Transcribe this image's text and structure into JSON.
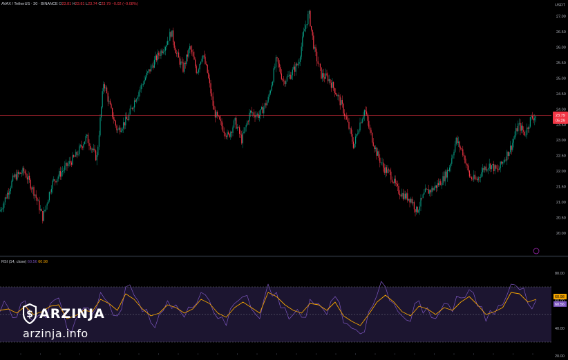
{
  "header": {
    "symbol": "AVAX / TetherUS · 30 · BINANCE",
    "open_label": "O",
    "open": "23.81",
    "high_label": "H",
    "high": "23.81",
    "low_label": "L",
    "low": "23.74",
    "close_label": "C",
    "close": "23.79",
    "change": "−0.02 (−0.08%)"
  },
  "price_axis": {
    "currency": "USDT"
  },
  "last_price_badge": {
    "price": "23.79",
    "countdown": "05:29"
  },
  "rsi_header": {
    "label": "RSI (14, close)",
    "value1": "60.56",
    "value2": "60.98"
  },
  "rsi_badges": {
    "value2": "60.98",
    "value1": "60.56"
  },
  "watermark": {
    "brand": "ARZINJA",
    "site": "arzinja.info"
  },
  "colors": {
    "background": "#000000",
    "up_candle": "#089981",
    "down_candle": "#f23645",
    "rsi_line": "#7e57c2",
    "rsi_ma": "#f7a600",
    "rsi_band_fill": "#1c1530",
    "price_line": "#f23645"
  },
  "chart_data": [
    {
      "type": "candlestick",
      "title": "AVAX / TetherUS · 30 · BINANCE",
      "ylim": [
        19.6,
        27.3
      ],
      "y_ticks": [
        "20.00",
        "20.50",
        "21.00",
        "21.50",
        "22.00",
        "22.50",
        "23.00",
        "23.50",
        "24.00",
        "24.50",
        "25.00",
        "25.50",
        "26.00",
        "26.50",
        "27.00"
      ],
      "last_price": 23.79,
      "close_path": [
        [
          0,
          20.7
        ],
        [
          20,
          21.8
        ],
        [
          35,
          22.0
        ],
        [
          50,
          21.3
        ],
        [
          62,
          20.5
        ],
        [
          75,
          21.6
        ],
        [
          90,
          22.0
        ],
        [
          110,
          22.5
        ],
        [
          125,
          23.1
        ],
        [
          140,
          22.4
        ],
        [
          150,
          24.9
        ],
        [
          160,
          24.0
        ],
        [
          170,
          23.3
        ],
        [
          185,
          23.7
        ],
        [
          195,
          24.3
        ],
        [
          210,
          25.0
        ],
        [
          225,
          25.6
        ],
        [
          240,
          26.1
        ],
        [
          248,
          26.5
        ],
        [
          255,
          25.8
        ],
        [
          265,
          25.3
        ],
        [
          275,
          26.0
        ],
        [
          285,
          25.2
        ],
        [
          293,
          25.8
        ],
        [
          300,
          25.2
        ],
        [
          310,
          23.9
        ],
        [
          320,
          23.5
        ],
        [
          330,
          23.1
        ],
        [
          340,
          23.6
        ],
        [
          350,
          23.0
        ],
        [
          362,
          23.9
        ],
        [
          375,
          23.8
        ],
        [
          388,
          24.3
        ],
        [
          400,
          25.6
        ],
        [
          410,
          24.9
        ],
        [
          420,
          25.1
        ],
        [
          432,
          25.5
        ],
        [
          440,
          26.5
        ],
        [
          447,
          27.1
        ],
        [
          455,
          25.9
        ],
        [
          465,
          25.1
        ],
        [
          475,
          25.0
        ],
        [
          485,
          24.6
        ],
        [
          495,
          24.1
        ],
        [
          505,
          23.4
        ],
        [
          512,
          22.8
        ],
        [
          520,
          23.5
        ],
        [
          528,
          24.0
        ],
        [
          535,
          23.3
        ],
        [
          545,
          22.6
        ],
        [
          555,
          22.1
        ],
        [
          565,
          21.9
        ],
        [
          575,
          21.4
        ],
        [
          585,
          21.2
        ],
        [
          595,
          21.1
        ],
        [
          603,
          20.7
        ],
        [
          615,
          21.3
        ],
        [
          625,
          21.4
        ],
        [
          640,
          21.7
        ],
        [
          650,
          22.1
        ],
        [
          660,
          23.0
        ],
        [
          670,
          22.6
        ],
        [
          680,
          21.8
        ],
        [
          690,
          21.7
        ],
        [
          700,
          22.1
        ],
        [
          710,
          22.2
        ],
        [
          720,
          22.0
        ],
        [
          730,
          22.4
        ],
        [
          740,
          22.8
        ],
        [
          750,
          23.5
        ],
        [
          760,
          23.2
        ],
        [
          768,
          23.7
        ],
        [
          776,
          23.79
        ]
      ]
    },
    {
      "type": "line",
      "title": "RSI (14, close)",
      "ylim": [
        28,
        84
      ],
      "y_ticks": [
        "80.00",
        "60.00",
        "40.00",
        "20.00"
      ],
      "bands": [
        30,
        70
      ],
      "series": [
        {
          "name": "60.56",
          "values": [
            52,
            55,
            48,
            60,
            45,
            50,
            58,
            62,
            40,
            46,
            55,
            50,
            66,
            58,
            49,
            70,
            64,
            52,
            44,
            50,
            60,
            57,
            48,
            55,
            66,
            60,
            47,
            42,
            58,
            63,
            54,
            47,
            72,
            66,
            55,
            50,
            48,
            61,
            58,
            50,
            63,
            44,
            40,
            36,
            52,
            64,
            70,
            58,
            49,
            45,
            60,
            55,
            47,
            58,
            52,
            62,
            68,
            56,
            45,
            50,
            57,
            72,
            68,
            58,
            60.56
          ]
        },
        {
          "name": "60.98",
          "values": [
            53,
            54,
            51,
            56,
            50,
            52,
            56,
            57,
            47,
            49,
            53,
            52,
            61,
            58,
            53,
            65,
            61,
            54,
            49,
            51,
            57,
            55,
            51,
            54,
            61,
            58,
            51,
            48,
            55,
            59,
            55,
            51,
            66,
            63,
            57,
            53,
            51,
            58,
            57,
            53,
            59,
            49,
            45,
            42,
            50,
            59,
            64,
            59,
            52,
            49,
            56,
            54,
            50,
            55,
            53,
            59,
            63,
            57,
            50,
            52,
            55,
            66,
            65,
            59,
            60.98
          ]
        }
      ]
    }
  ]
}
